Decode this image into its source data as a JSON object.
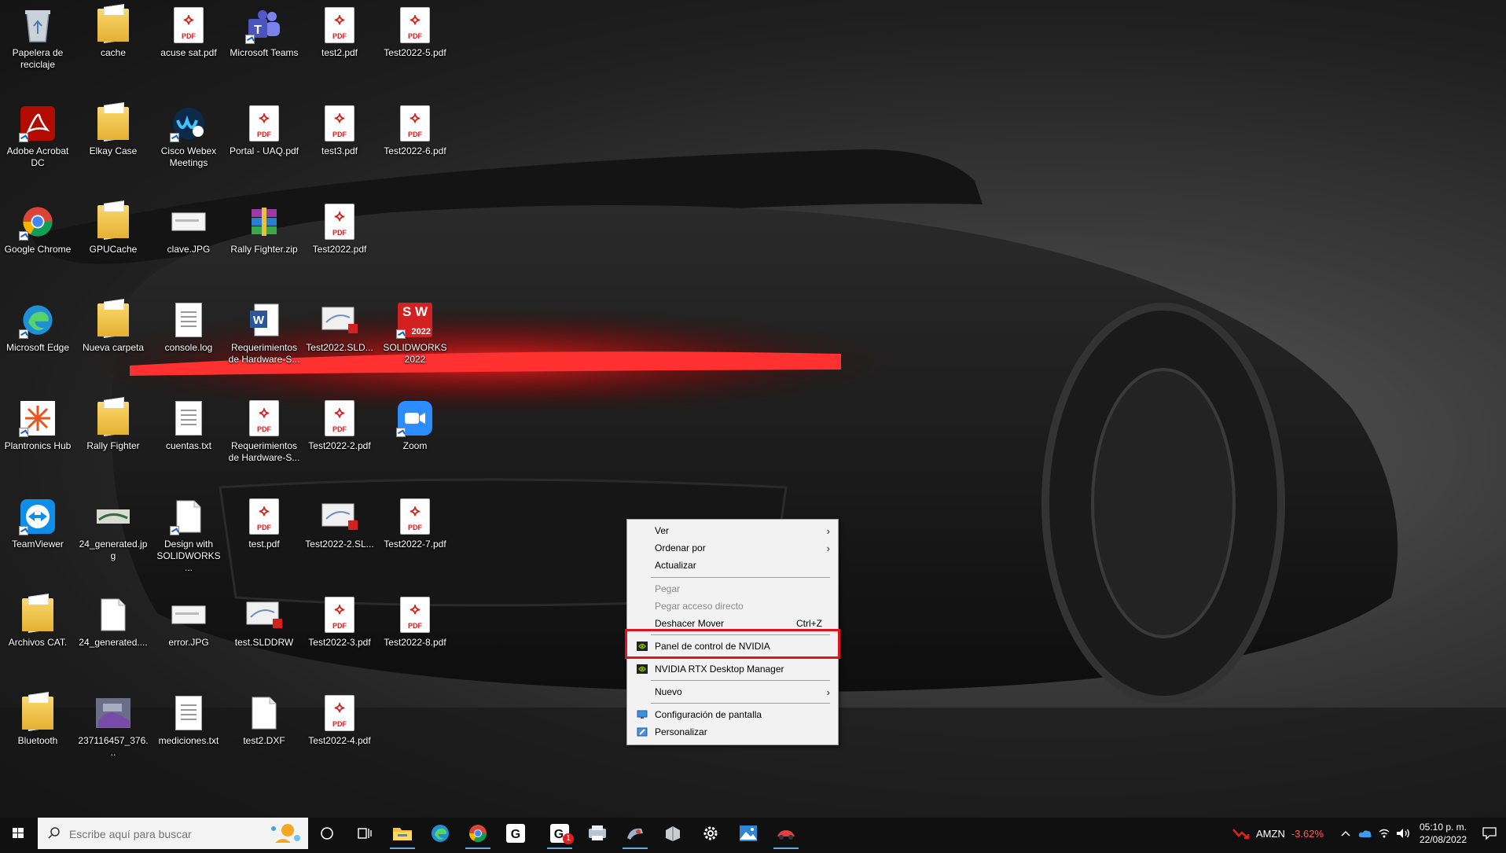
{
  "desktop_icons": [
    {
      "label": "Papelera de reciclaje",
      "type": "recycle"
    },
    {
      "label": "cache",
      "type": "folder"
    },
    {
      "label": "acuse sat.pdf",
      "type": "pdf"
    },
    {
      "label": "Microsoft Teams",
      "type": "teams"
    },
    {
      "label": "test2.pdf",
      "type": "pdf"
    },
    {
      "label": "Test2022-5.pdf",
      "type": "pdf"
    },
    {
      "label": "Adobe Acrobat DC",
      "type": "acrobat"
    },
    {
      "label": "Elkay Case",
      "type": "folder"
    },
    {
      "label": "Cisco Webex Meetings",
      "type": "webex"
    },
    {
      "label": "Portal - UAQ.pdf",
      "type": "pdf"
    },
    {
      "label": "test3.pdf",
      "type": "pdf"
    },
    {
      "label": "Test2022-6.pdf",
      "type": "pdf"
    },
    {
      "label": "Google Chrome",
      "type": "chrome"
    },
    {
      "label": "GPUCache",
      "type": "folder"
    },
    {
      "label": "clave.JPG",
      "type": "image"
    },
    {
      "label": "Rally Fighter.zip",
      "type": "zip"
    },
    {
      "label": "Test2022.pdf",
      "type": "pdf"
    },
    {
      "label": "Microsoft Edge",
      "type": "edge"
    },
    {
      "label": "Nueva carpeta",
      "type": "folder"
    },
    {
      "label": "console.log",
      "type": "txt"
    },
    {
      "label": "Requerimientos de Hardware-S...",
      "type": "word"
    },
    {
      "label": "Test2022.SLD...",
      "type": "sldrw"
    },
    {
      "label": "SOLIDWORKS 2022",
      "type": "solidworks"
    },
    {
      "label": "Plantronics Hub",
      "type": "plantronics"
    },
    {
      "label": "Rally Fighter",
      "type": "folder"
    },
    {
      "label": "cuentas.txt",
      "type": "txt"
    },
    {
      "label": "Requerimientos de Hardware-S...",
      "type": "pdf"
    },
    {
      "label": "Test2022-2.pdf",
      "type": "pdf"
    },
    {
      "label": "Zoom",
      "type": "zoom"
    },
    {
      "label": "TeamViewer",
      "type": "teamviewer"
    },
    {
      "label": "24_generated.jpg",
      "type": "image2"
    },
    {
      "label": "Design with SOLIDWORKS ...",
      "type": "doc"
    },
    {
      "label": "test.pdf",
      "type": "pdf"
    },
    {
      "label": "Test2022-2.SL...",
      "type": "sldrw"
    },
    {
      "label": "Test2022-7.pdf",
      "type": "pdf"
    },
    {
      "label": "Archivos CAT.",
      "type": "folder"
    },
    {
      "label": "24_generated....",
      "type": "doc"
    },
    {
      "label": "error.JPG",
      "type": "image"
    },
    {
      "label": "test.SLDDRW",
      "type": "sldrw"
    },
    {
      "label": "Test2022-3.pdf",
      "type": "pdf"
    },
    {
      "label": "Test2022-8.pdf",
      "type": "pdf"
    },
    {
      "label": "Bluetooth",
      "type": "folder"
    },
    {
      "label": "237116457_376...",
      "type": "photo"
    },
    {
      "label": "mediciones.txt",
      "type": "txt"
    },
    {
      "label": "test2.DXF",
      "type": "doc"
    },
    {
      "label": "Test2022-4.pdf",
      "type": "pdf"
    }
  ],
  "pdf_tag": "PDF",
  "sw_badge": {
    "top": "S W",
    "bottom": "2022"
  },
  "context_menu": {
    "ver": "Ver",
    "ordenar": "Ordenar por",
    "actualizar": "Actualizar",
    "pegar": "Pegar",
    "pegar_acceso": "Pegar acceso directo",
    "deshacer": "Deshacer Mover",
    "deshacer_shortcut": "Ctrl+Z",
    "nvidia_panel": "Panel de control de NVIDIA",
    "nvidia_rtx": "NVIDIA RTX Desktop Manager",
    "nuevo": "Nuevo",
    "config_pantalla": "Configuración de pantalla",
    "personalizar": "Personalizar"
  },
  "taskbar": {
    "search_placeholder": "Escribe aquí para buscar",
    "gmail_badge": "1",
    "stock_symbol": "AMZN",
    "stock_change": "-3.62%",
    "time": "05:10 p. m.",
    "date": "22/08/2022"
  },
  "colors": {
    "highlight": "#e0141e",
    "stock_down": "#ff5a5a",
    "nvidia": "#76b900"
  }
}
